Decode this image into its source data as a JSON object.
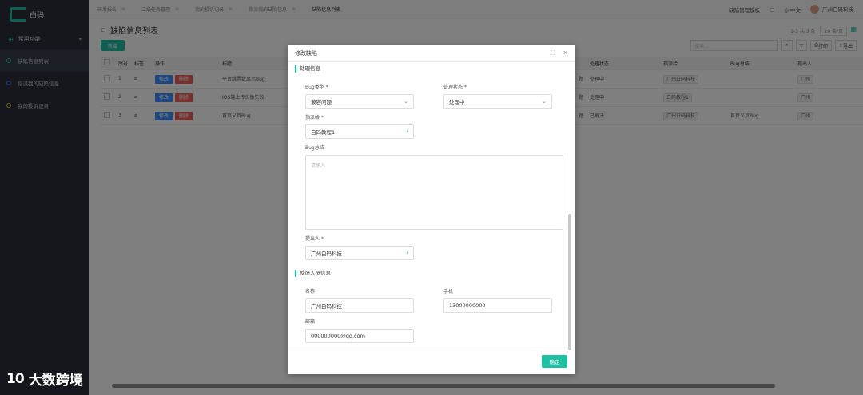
{
  "app": {
    "logo_text": "白码"
  },
  "sidebar": {
    "group_label": "常用功能",
    "items": [
      {
        "label": "缺陷信息列表"
      },
      {
        "label": "指派我的缺陷信息"
      },
      {
        "label": "我的投诉记录"
      }
    ]
  },
  "tabs": [
    {
      "label": "研发报告"
    },
    {
      "label": "二级任务管理"
    },
    {
      "label": "我的投诉记录"
    },
    {
      "label": "指派我的缺陷信息"
    },
    {
      "label": "缺陷信息列表"
    }
  ],
  "topbar": {
    "manage_label": "缺陷管理模板",
    "lang_label": "中文",
    "company": "广州白码科技"
  },
  "page": {
    "title": "缺陷信息列表",
    "add_label": "新增",
    "pager_text": "1-3 共 3 条",
    "page_size": "20 条/页",
    "search_placeholder": "搜索...",
    "print_label": "打印",
    "export_label": "导出"
  },
  "table": {
    "headers": [
      "序号",
      "标签",
      "操作",
      "标题",
      "处理状态",
      "指派给",
      "Bug总结",
      "提出人"
    ],
    "edit_label": "修改",
    "delete_label": "删除",
    "rows": [
      {
        "no": "1",
        "title": "平台跳票数显示Bug",
        "type_frag": "题",
        "status": "处理中",
        "assignee": "广州白码科技",
        "summary": "",
        "reporter": "广州"
      },
      {
        "no": "2",
        "title": "IOS端上传头像失败",
        "type_frag": "题",
        "status": "处理中",
        "assignee": "白码教程1",
        "summary": "",
        "reporter": "广州"
      },
      {
        "no": "3",
        "title": "首页义页Bug",
        "type_frag": "题",
        "status": "已解决",
        "assignee": "广州白码科技",
        "summary": "首页义页Bug",
        "reporter": "广州"
      }
    ]
  },
  "modal": {
    "title": "修改缺陷",
    "section_processing": "处理信息",
    "bug_type_label": "Bug类型 *",
    "bug_type_value": "兼容问题",
    "status_label": "处理状态 *",
    "status_value": "处理中",
    "assignee_label": "指派给 *",
    "assignee_value": "白码教程1",
    "summary_label": "Bug总结",
    "summary_placeholder": "请输入",
    "reporter_label": "提出人 *",
    "reporter_value": "广州白码科技",
    "section_feedback": "反馈人员信息",
    "name_label": "名称",
    "name_value": "广州白码科技",
    "phone_label": "手机",
    "phone_value": "13000000000",
    "email_label": "邮箱",
    "email_value": "000000000@qq.com",
    "ok_label": "确定"
  },
  "watermark": {
    "logo": "10",
    "text": "大数跨境"
  }
}
